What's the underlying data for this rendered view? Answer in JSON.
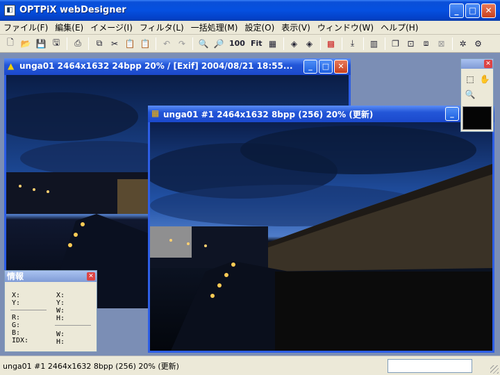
{
  "app": {
    "title": "OPTPiX webDesigner",
    "app_icon": "optpix-app-icon",
    "caption_minimize": "_",
    "caption_maximize": "□",
    "caption_close": "✕"
  },
  "menu": [
    "ファイル(F)",
    "編集(E)",
    "イメージ(I)",
    "フィルタ(L)",
    "一括処理(M)",
    "設定(O)",
    "表示(V)",
    "ウィンドウ(W)",
    "ヘルプ(H)"
  ],
  "toolbar": {
    "zoom_100": "100",
    "fit": "Fit"
  },
  "window1": {
    "title": "unga01  2464x1632  24bpp  20% / [Exif] 2004/08/21 18:55...",
    "icon": "rgb-triangle-icon"
  },
  "window2": {
    "title": "unga01 #1  2464x1632  8bpp (256) 20% (更新)",
    "icon": "palette-grid-icon"
  },
  "info_panel": {
    "title": "情報",
    "labels_left_top": [
      "X:",
      "Y:"
    ],
    "labels_left_bottom": [
      "R:",
      "G:",
      "B:",
      "IDX:"
    ],
    "labels_right_top": [
      "X:",
      "Y:",
      "W:",
      "H:"
    ],
    "labels_right_bottom": [
      "W:",
      "H:"
    ]
  },
  "statusbar": {
    "text": "unga01 #1  2464x1632  8bpp (256) 20% (更新)"
  },
  "colors": {
    "title_blue": "#0550e0",
    "window_frame": "#2d5ee6",
    "mdi_background": "#7b8eb5",
    "face": "#ece9d8"
  }
}
